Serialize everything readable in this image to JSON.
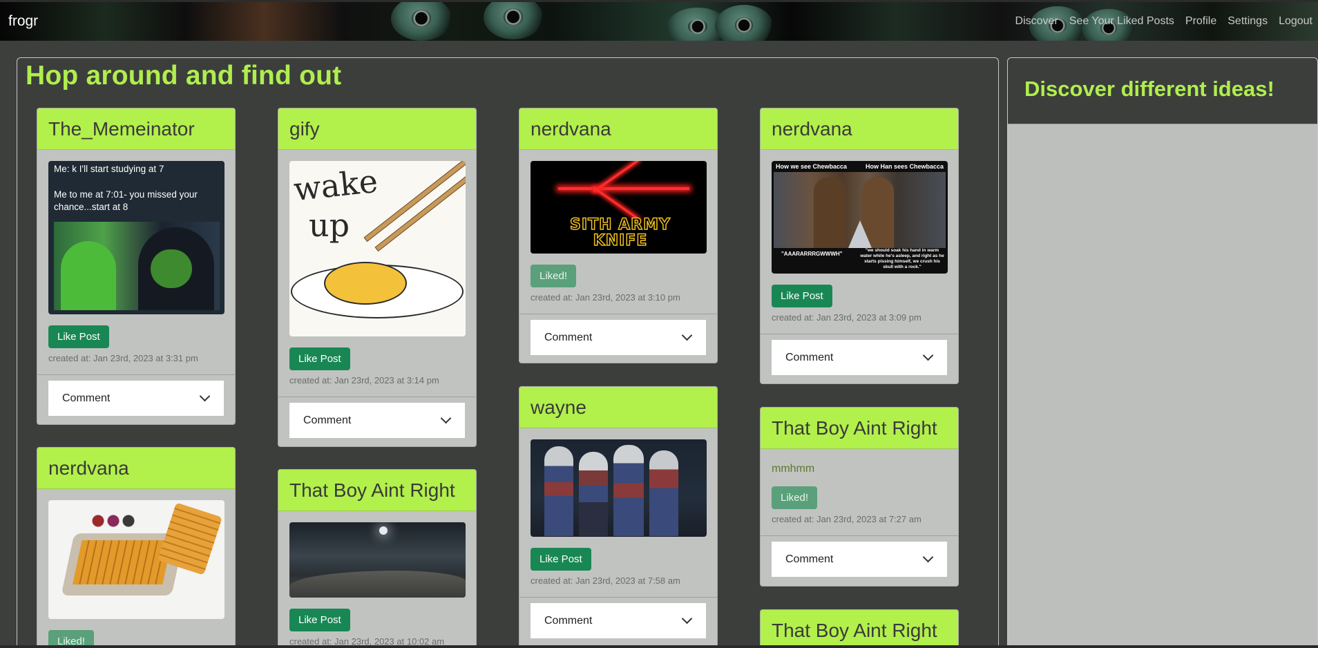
{
  "navbar": {
    "brand": "frogr",
    "links": [
      "Discover",
      "See Your Liked Posts",
      "Profile",
      "Settings",
      "Logout"
    ]
  },
  "main": {
    "title": "Hop around and find out"
  },
  "sidebar": {
    "title": "Discover different ideas!"
  },
  "posts": [
    {
      "user": "The_Memeinator",
      "image_text": [
        "Me: k I'll start studying at 7",
        "Me to me at 7:01- you missed your chance...start at 8"
      ],
      "button": "Like Post",
      "created": "created at: Jan 23rd, 2023 at 3:31 pm",
      "comment": "Comment"
    },
    {
      "user": "nerdvana",
      "button": "Liked!"
    },
    {
      "user": "gify",
      "image_text": [
        "wake",
        "up"
      ],
      "button": "Like Post",
      "created": "created at: Jan 23rd, 2023 at 3:14 pm",
      "comment": "Comment"
    },
    {
      "user": "That Boy Aint Right",
      "button": "Like Post",
      "created": "created at: Jan 23rd, 2023 at 10:02 am"
    },
    {
      "user": "nerdvana",
      "image_text": [
        "SITH ARMY",
        "KNIFE"
      ],
      "button": "Liked!",
      "created": "created at: Jan 23rd, 2023 at 3:10 pm",
      "comment": "Comment"
    },
    {
      "user": "wayne",
      "button": "Like Post",
      "created": "created at: Jan 23rd, 2023 at 7:58 am",
      "comment": "Comment"
    },
    {
      "user": "nerdvana",
      "image_text": [
        "How we see Chewbacca",
        "How Han sees Chewbacca",
        "\"AAARARRRGWWWH\"",
        "\"we should soak his hand in warm water while he's asleep, and right as he starts pissing himself, we crush his skull with a rock.\""
      ],
      "button": "Like Post",
      "created": "created at: Jan 23rd, 2023 at 3:09 pm",
      "comment": "Comment"
    },
    {
      "user": "That Boy Aint Right",
      "text": "mmhmm",
      "button": "Liked!",
      "created": "created at: Jan 23rd, 2023 at 7:27 am",
      "comment": "Comment"
    },
    {
      "user": "That Boy Aint Right"
    }
  ]
}
